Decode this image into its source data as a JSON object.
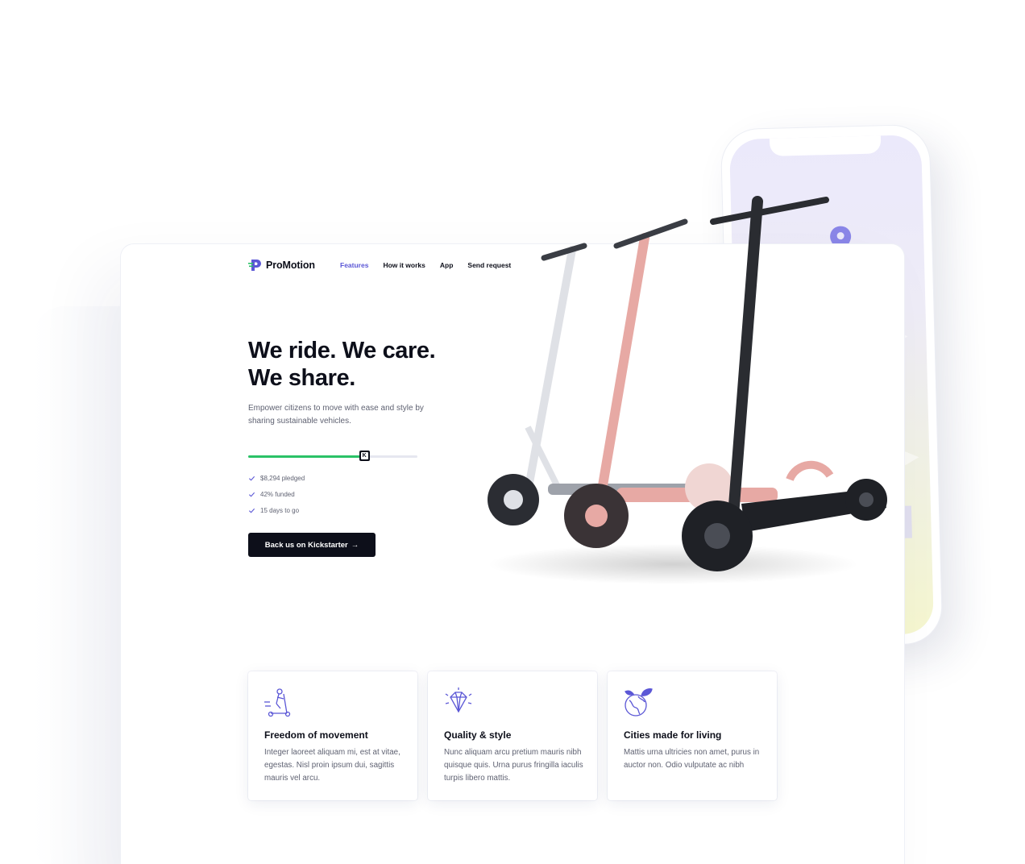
{
  "brand": {
    "name": "ProMotion",
    "accent": "#5b57d6",
    "progress_color": "#2bc267"
  },
  "nav": [
    {
      "label": "Features",
      "active": true
    },
    {
      "label": "How it works",
      "active": false
    },
    {
      "label": "App",
      "active": false
    },
    {
      "label": "Send request",
      "active": false
    }
  ],
  "hero": {
    "title_line1": "We ride. We care.",
    "title_line2": "We share.",
    "subtitle": "Empower citizens to move with ease and style by sharing sustainable vehicles.",
    "funded_fraction": 0.66,
    "kickstarter_icon": "kickstarter-icon"
  },
  "stats": [
    {
      "label": "$8,294 pledged",
      "icon": "check-icon"
    },
    {
      "label": "42% funded",
      "icon": "check-icon"
    },
    {
      "label": "15 days to go",
      "icon": "check-icon"
    }
  ],
  "cta": {
    "label": "Back us on Kickstarter",
    "arrow": "→"
  },
  "features": [
    {
      "icon": "scooter-rider-icon",
      "title": "Freedom of movement",
      "body": "Integer laoreet aliquam mi, est at vitae, egestas. Nisl proin ipsum dui, sagittis mauris vel arcu."
    },
    {
      "icon": "diamond-icon",
      "title": "Quality & style",
      "body": "Nunc aliquam arcu pretium mauris nibh quisque quis. Urna purus fringilla iaculis turpis libero mattis."
    },
    {
      "icon": "globe-leaves-icon",
      "title": "Cities made for living",
      "body": "Mattis urna ultricies non amet, purus in auctor non. Odio vulputate ac nibh"
    }
  ]
}
